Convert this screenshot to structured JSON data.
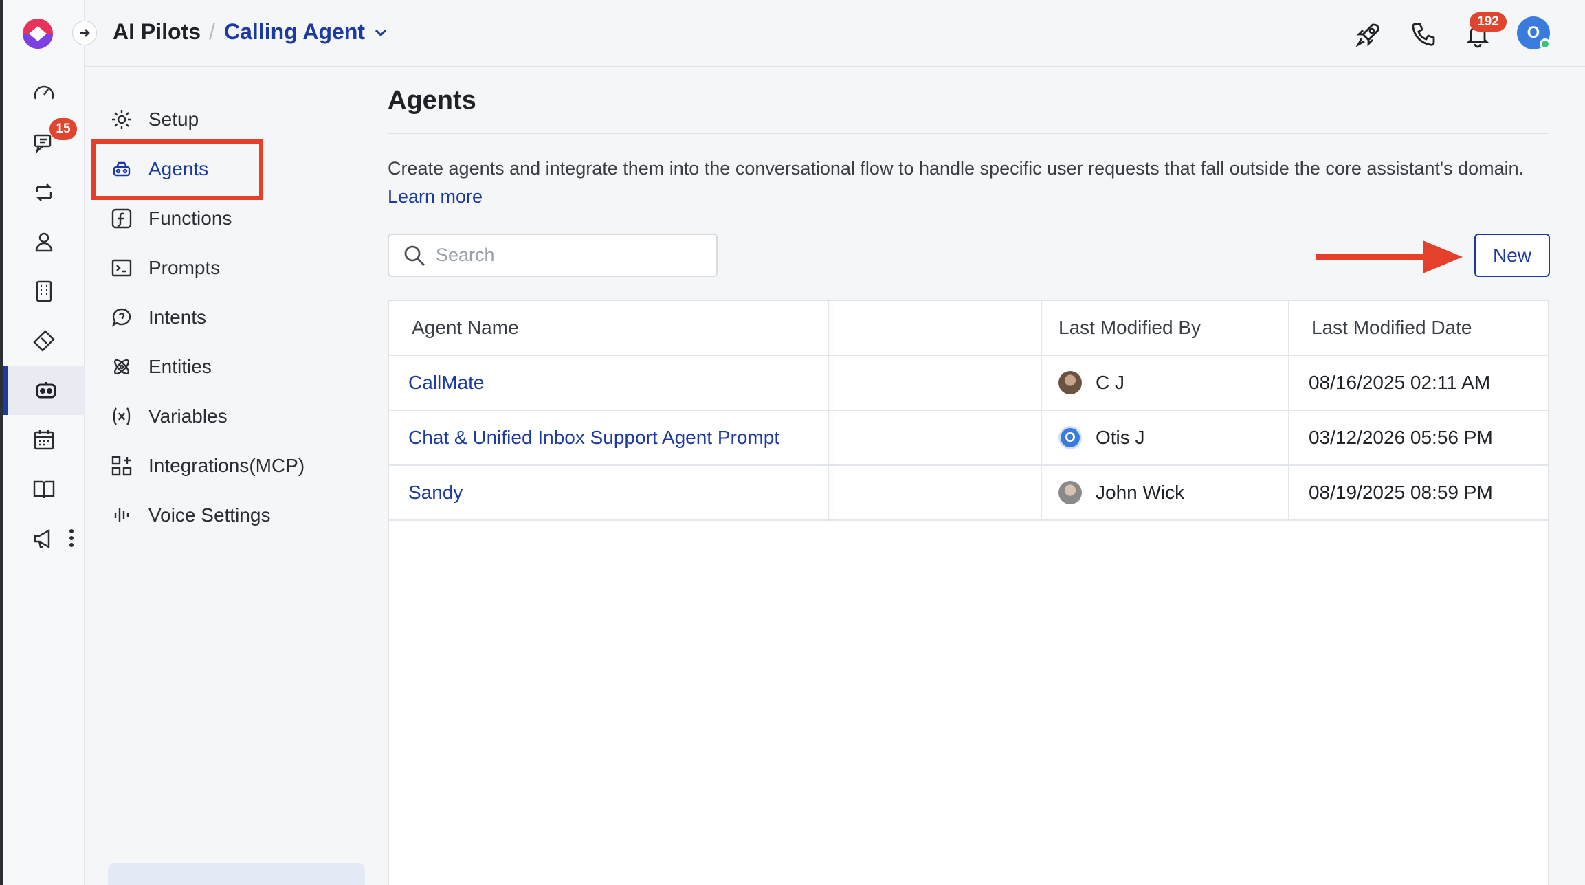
{
  "header": {
    "breadcrumb_root": "AI Pilots",
    "breadcrumb_separator": "/",
    "breadcrumb_current": "Calling Agent",
    "notification_count": "192",
    "user_initial": "O"
  },
  "rail": {
    "conversations_badge": "15",
    "icons": [
      "dashboard-icon",
      "conversations-icon",
      "workflows-icon",
      "contacts-icon",
      "company-icon",
      "tickets-icon",
      "ai-pilots-icon",
      "calendar-icon",
      "knowledge-icon",
      "campaigns-icon"
    ],
    "active": "ai-pilots-icon"
  },
  "subnav": {
    "items": [
      {
        "label": "Setup",
        "icon": "gear-icon"
      },
      {
        "label": "Agents",
        "icon": "agents-icon"
      },
      {
        "label": "Functions",
        "icon": "function-icon"
      },
      {
        "label": "Prompts",
        "icon": "prompt-icon"
      },
      {
        "label": "Intents",
        "icon": "intent-icon"
      },
      {
        "label": "Entities",
        "icon": "entities-icon"
      },
      {
        "label": "Variables",
        "icon": "variables-icon"
      },
      {
        "label": "Integrations(MCP)",
        "icon": "integrations-icon"
      },
      {
        "label": "Voice Settings",
        "icon": "voice-icon"
      }
    ],
    "active": "Agents"
  },
  "main": {
    "title": "Agents",
    "description": "Create agents and integrate them into the conversational flow to handle specific user requests that fall outside the core assistant's domain.",
    "learn_more": "Learn more",
    "search_placeholder": "Search",
    "new_button": "New"
  },
  "table": {
    "headers": [
      "Agent Name",
      "Last Modified By",
      "Last Modified Date"
    ],
    "rows": [
      {
        "name": "CallMate",
        "modified_by": "C J",
        "date": "08/16/2025 02:11 AM"
      },
      {
        "name": "Chat & Unified Inbox Support Agent Prompt",
        "modified_by": "Otis J",
        "avatar_initial": "O",
        "date": "03/12/2026 05:56 PM"
      },
      {
        "name": "Sandy",
        "modified_by": "John Wick",
        "date": "08/19/2025 08:59 PM"
      }
    ]
  },
  "colors": {
    "accent": "#1c3aa0",
    "badge": "#e0452d",
    "annotation": "#e4402a"
  }
}
